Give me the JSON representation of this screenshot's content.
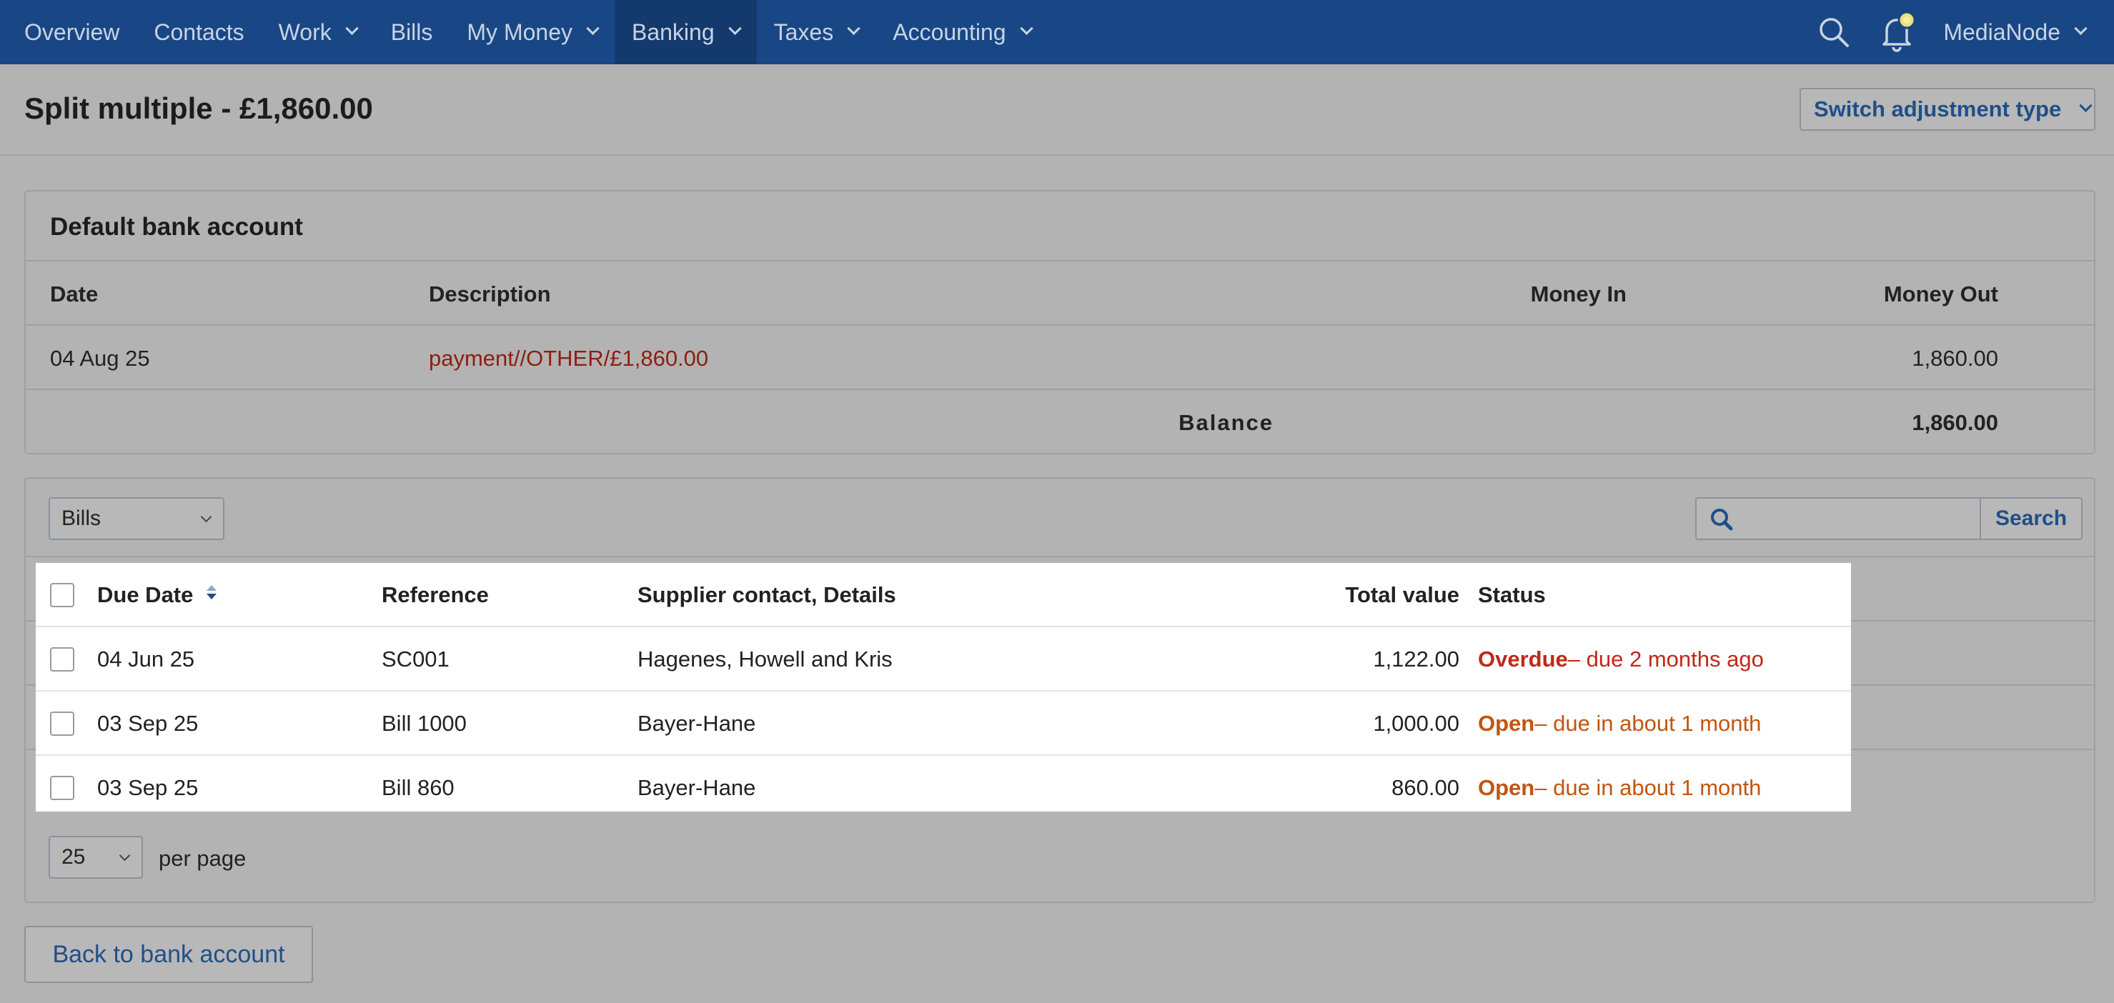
{
  "nav": {
    "items": [
      {
        "label": "Overview",
        "dropdown": false
      },
      {
        "label": "Contacts",
        "dropdown": false
      },
      {
        "label": "Work",
        "dropdown": true
      },
      {
        "label": "Bills",
        "dropdown": false
      },
      {
        "label": "My Money",
        "dropdown": true
      },
      {
        "label": "Banking",
        "dropdown": true,
        "active": true
      },
      {
        "label": "Taxes",
        "dropdown": true
      },
      {
        "label": "Accounting",
        "dropdown": true
      }
    ],
    "user": "MediaNode",
    "icons": [
      "search-icon",
      "notification-bell-icon",
      "chevron-down-icon"
    ]
  },
  "header": {
    "title": "Split multiple - £1,860.00",
    "switch_label": "Switch adjustment type"
  },
  "bank": {
    "title": "Default bank account",
    "columns": {
      "date": "Date",
      "description": "Description",
      "money_in": "Money In",
      "money_out": "Money Out"
    },
    "row": {
      "date": "04 Aug 25",
      "description": "payment//OTHER/£1,860.00",
      "money_in": "",
      "money_out": "1,860.00"
    },
    "balance_label": "Balance",
    "balance_value": "1,860.00"
  },
  "bills": {
    "filter_value": "Bills",
    "search_placeholder": "",
    "search_label": "Search",
    "columns": {
      "due_date": "Due Date",
      "reference": "Reference",
      "supplier": "Supplier contact, Details",
      "total": "Total value",
      "status": "Status"
    },
    "rows": [
      {
        "due_date": "04 Jun 25",
        "reference": "SC001",
        "supplier": "Hagenes, Howell and Kris",
        "total": "1,122.00",
        "status": "Overdue",
        "status_detail": " – due 2 months ago"
      },
      {
        "due_date": "03 Sep 25",
        "reference": "Bill 1000",
        "supplier": "Bayer-Hane",
        "total": "1,000.00",
        "status": "Open",
        "status_detail": " – due in about 1 month"
      },
      {
        "due_date": "03 Sep 25",
        "reference": "Bill 860",
        "supplier": "Bayer-Hane",
        "total": "860.00",
        "status": "Open",
        "status_detail": " – due in about 1 month"
      }
    ],
    "per_page_value": "25",
    "per_page_label": "per page"
  },
  "footer": {
    "back_label": "Back to bank account"
  },
  "colors": {
    "nav_bg": "#194785",
    "link": "#1f4f8a",
    "overdue": "#c0281a",
    "open": "#c25511",
    "description_red": "#8c2010"
  }
}
